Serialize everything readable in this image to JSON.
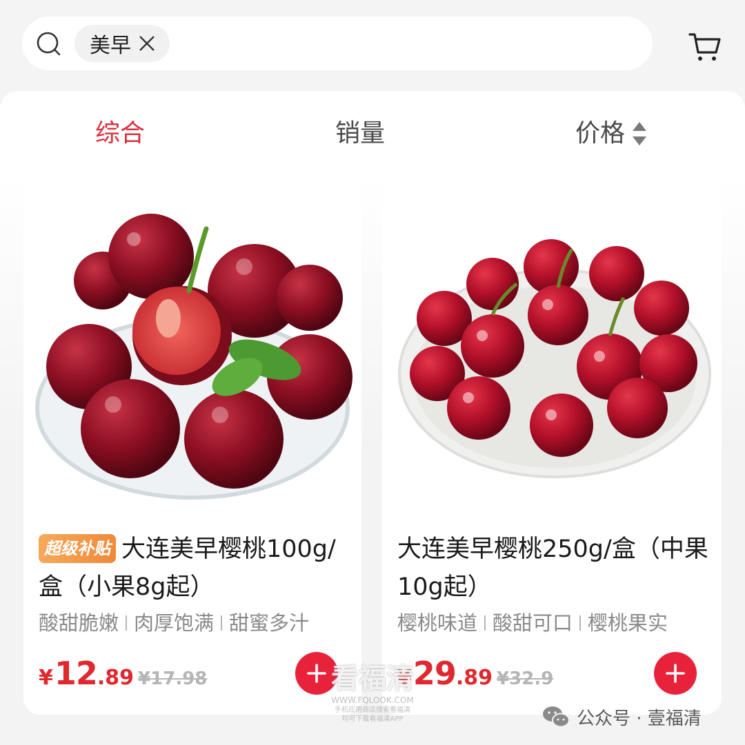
{
  "search": {
    "chip_label": "美早"
  },
  "sort_tabs": [
    {
      "label": "综合",
      "active": true
    },
    {
      "label": "销量",
      "active": false
    },
    {
      "label": "价格",
      "active": false
    }
  ],
  "products": [
    {
      "badge": "超级补贴",
      "title": "大连美早樱桃100g/盒（小果8g起）",
      "tags": [
        "酸甜脆嫩",
        "肉厚饱满",
        "甜蜜多汁"
      ],
      "currency": "¥",
      "price_int": "12",
      "price_dec": ".89",
      "original_price": "¥17.98"
    },
    {
      "badge": "",
      "title": "大连美早樱桃250g/盒（中果10g起）",
      "tags": [
        "樱桃味道",
        "酸甜可口",
        "樱桃果实"
      ],
      "currency": "¥",
      "price_int": "29",
      "price_dec": ".89",
      "original_price": "¥32.9"
    }
  ],
  "watermark": {
    "center_title": "看福清",
    "center_url": "WWW.FQLOOK.COM",
    "center_note_1": "手机应用商店搜索看福清",
    "center_note_2": "均可下载看福清APP",
    "wechat_text": "公众号 · 壹福清"
  },
  "colors": {
    "accent": "#d8303d",
    "price": "#e0282f",
    "add_button": "#e8223a",
    "badge": "#ef8a39"
  }
}
